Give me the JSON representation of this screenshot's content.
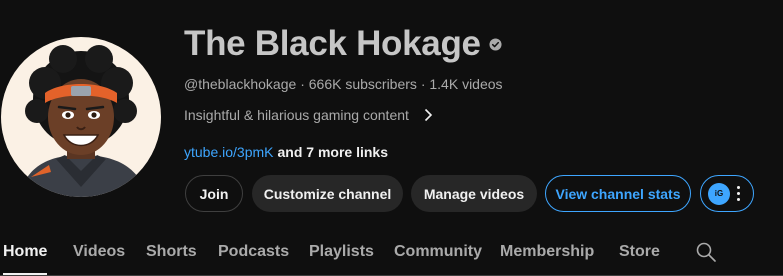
{
  "channel": {
    "name": "The Black Hokage",
    "handle": "@theblackhokage",
    "subscribers": "666K subscribers",
    "videos": "1.4K videos",
    "meta_separator": "·",
    "description": "Insightful & hilarious gaming content",
    "link": "ytube.io/3pmK",
    "more_links": "and 7 more links"
  },
  "buttons": {
    "join": "Join",
    "customize": "Customize channel",
    "manage": "Manage videos",
    "stats": "View channel stats",
    "badge": "iG"
  },
  "tabs": [
    {
      "label": "Home",
      "active": true
    },
    {
      "label": "Videos"
    },
    {
      "label": "Shorts"
    },
    {
      "label": "Podcasts"
    },
    {
      "label": "Playlists"
    },
    {
      "label": "Community"
    },
    {
      "label": "Membership"
    },
    {
      "label": "Store"
    }
  ],
  "icons": {
    "verified": "verified-check-icon",
    "description_expand": "chevron-right-icon",
    "more": "more-vert-icon",
    "search": "search-icon"
  },
  "colors": {
    "background": "#0f0f0f",
    "link": "#3ea6ff",
    "secondary_text": "#aaaaaa",
    "button_bg": "#272727"
  }
}
